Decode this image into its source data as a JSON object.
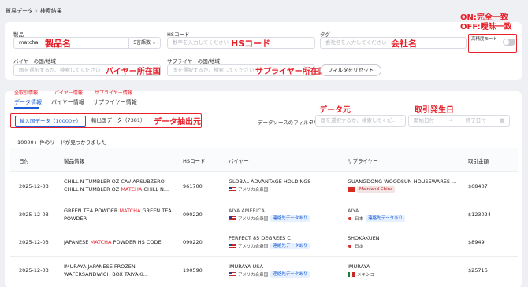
{
  "breadcrumb": {
    "root": "貿易データ",
    "separator": "›",
    "current": "検索結果"
  },
  "filters": {
    "product_label": "製品",
    "product_value": "matcha",
    "lang_select": "5言語数",
    "hs_label": "HSコード",
    "hs_placeholder": "数字を入力してください",
    "tag_label": "タグ",
    "tag_placeholder": "会社名を入力してください",
    "precision_label": "高精度モード",
    "buyer_country_label": "バイヤーの国/地域",
    "buyer_country_placeholder": "国を選択するか、検索してください",
    "supplier_country_label": "サプライヤーの国/地域",
    "supplier_country_placeholder": "国を選択するか、検索してください",
    "reset_button": "フィルタをリセット"
  },
  "annotations": {
    "product": "製品名",
    "hs": "HSコード",
    "company": "会社名",
    "mode": "ON:完全一致\nOFF:曖昧一致",
    "buyer_country": "バイヤー所在国",
    "supplier_country": "サプライヤー所在国",
    "extract_source": "データ抽出元",
    "data_source": "データ元",
    "date": "取引発生日"
  },
  "top_tabs": {
    "all": "全取引情報",
    "buyer": "バイヤー情報",
    "supplier": "サプライヤー情報"
  },
  "sub_tabs": [
    "データ情報",
    "バイヤー情報",
    "サプライヤー情報"
  ],
  "toggle": {
    "import": "輸入国データ（10000+）",
    "export": "輸出国データ（7381）"
  },
  "source_filter": {
    "label": "データソースのフィルタリング:",
    "placeholder": "国を選択するか、検索してくだ...",
    "start": "開始日付",
    "arrow": "→",
    "end": "終了日付"
  },
  "result_count": "10000+ 件のリードが見つかりました",
  "columns": [
    "日付",
    "製品情報",
    "HSコード",
    "バイヤー",
    "サプライヤー",
    "取引金額"
  ],
  "rows": [
    {
      "date": "2025-12-03",
      "product_pre": "CHILL N TUMBLER OZ CAVIARSUBZERO CHILL N TUMBLER OZ ",
      "product_hl": "MATCHA",
      "product_post": ",CHILL N...",
      "hs": "961700",
      "buyer": "GLOBAL ADVANTAGE HOLDINGS",
      "buyer_country": "アメリカ合衆国",
      "buyer_badge": "",
      "supplier": "GUANGDONG WOODSUN HOUSEWARES ...",
      "supplier_country": "Mainland China",
      "supplier_badge": "",
      "amount": "$68407"
    },
    {
      "date": "2025-12-03",
      "product_pre": "GREEN TEA POWDER ",
      "product_hl": "MATCHA",
      "product_post": " GREEN TEA POWDER",
      "hs": "090220",
      "buyer": "AIYA AMERICA",
      "buyer_country": "アメリカ合衆国",
      "buyer_badge": "連絡先データあり",
      "supplier": "AIYA",
      "supplier_country": "日本",
      "supplier_badge": "連絡先データあり",
      "amount": "$123024"
    },
    {
      "date": "2025-12-03",
      "product_pre": "JAPANESE ",
      "product_hl": "MATCHA",
      "product_post": " POWDER HS CODE",
      "hs": "090220",
      "buyer": "PERFECT 85 DEGREES C",
      "buyer_country": "アメリカ合衆国",
      "buyer_badge": "連絡先データあり",
      "supplier": "SHOKAKUEN",
      "supplier_country": "日本",
      "supplier_badge": "",
      "amount": "$8949"
    },
    {
      "date": "2025-12-03",
      "product_pre": "IMURAYA JAPANESE FROZEN WAFERSANDWICH BOX TAIYAKI...",
      "product_hl": "",
      "product_post": "",
      "hs": "190590",
      "buyer": "IMURAYA USA",
      "buyer_country": "アメリカ合衆国",
      "buyer_badge": "連絡先データあり",
      "supplier": "IMURAYA",
      "supplier_country": "メキシコ",
      "supplier_badge": "",
      "amount": "$25716"
    }
  ]
}
